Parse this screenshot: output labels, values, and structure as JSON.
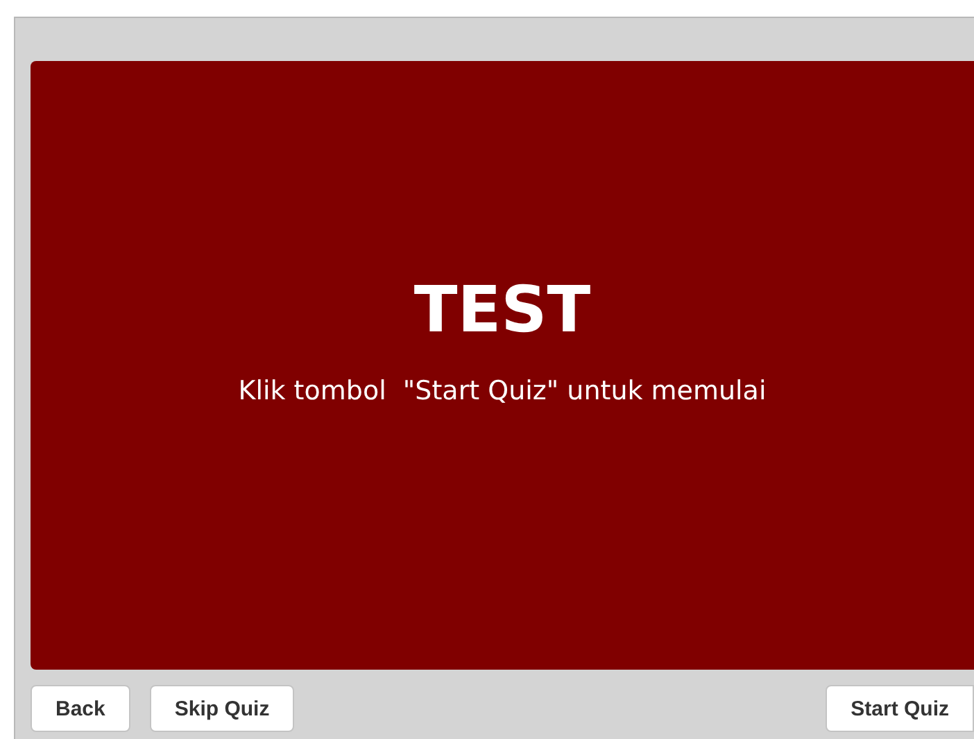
{
  "panel": {
    "title": "TEST",
    "subtitle": "Klik tombol  \"Start Quiz\" untuk memulai"
  },
  "buttons_left": [
    "Back",
    "Skip Quiz"
  ],
  "buttons_right": [
    "Start Quiz"
  ]
}
